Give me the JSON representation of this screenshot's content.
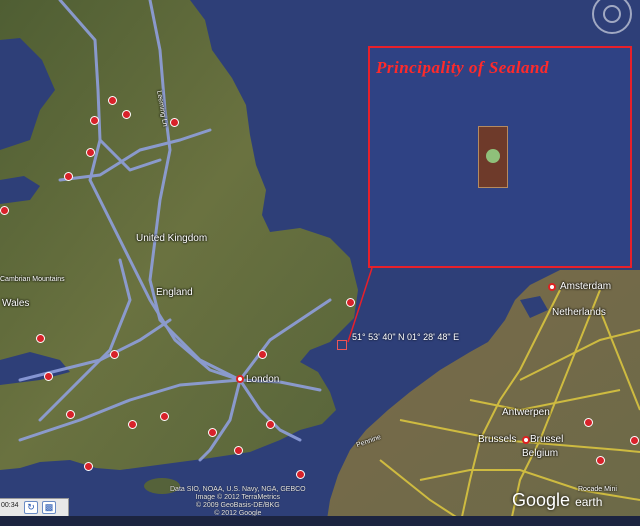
{
  "map": {
    "labels": {
      "uk": "United Kingdom",
      "england": "England",
      "london": "London",
      "wales": "Wales",
      "cambrian": "Cambrian Mountains",
      "amsterdam": "Amsterdam",
      "netherlands": "Netherlands",
      "antwerpen": "Antwerpen",
      "brussels": "Brussels",
      "brussel": "Brussel",
      "belgium": "Belgium",
      "rocade": "Rocade Mini",
      "leeming": "Leeming Ln",
      "pennine": "Pennine"
    },
    "coordinate": "51° 53' 40\" N 01° 28' 48\" E",
    "inset": {
      "title": "Principality of Sealand"
    },
    "credits": {
      "line1": "Data SIO, NOAA, U.S. Navy, NGA, GEBCO",
      "line2": "Image © 2012 TerraMetrics",
      "line3": "© 2009 GeoBasis-DE/BKG",
      "line4": "© 2012 Google"
    },
    "logo": {
      "google": "Google",
      "earth": "earth"
    },
    "tour_bar": {
      "time": "00:34"
    },
    "colors": {
      "sea": "#2e3f78",
      "land": "#5c6a3a",
      "highway": "#8f9fdc",
      "continental_roads": "#d9c440",
      "border": "#e8202a"
    }
  }
}
